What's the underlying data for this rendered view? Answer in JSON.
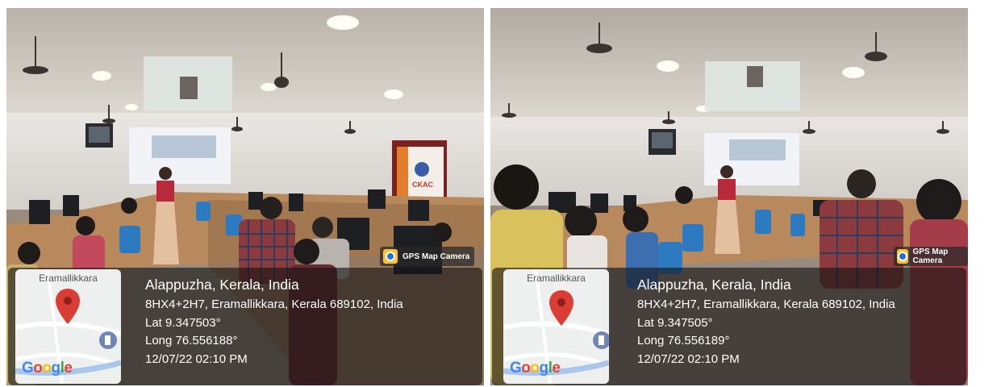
{
  "photos": [
    {
      "badge": "GPS Map Camera",
      "map_label": "Eramallikkara",
      "map_logo": [
        "G",
        "o",
        "o",
        "g",
        "l",
        "e"
      ],
      "place": "Alappuzha, Kerala, India",
      "address": "8HX4+2H7, Eramallikkara, Kerala 689102, India",
      "lat": "Lat 9.347503°",
      "long": "Long 76.556188°",
      "datetime": "12/07/22 02:10 PM",
      "banner_text": "CKAC"
    },
    {
      "badge": "GPS Map Camera",
      "map_label": "Eramallikkara",
      "map_logo": [
        "G",
        "o",
        "o",
        "g",
        "l",
        "e"
      ],
      "place": "Alappuzha, Kerala, India",
      "address": "8HX4+2H7, Eramallikkara, Kerala 689102, India",
      "lat": "Lat 9.347505°",
      "long": "Long 76.556189°",
      "datetime": "12/07/22 02:10 PM"
    }
  ],
  "colors": {
    "pin_red": "#d93d34",
    "badge_yellow": "#f6c531",
    "google_blue": "#4285f4",
    "google_red": "#ea4335",
    "google_yellow": "#fbbc05",
    "google_green": "#34a853"
  }
}
